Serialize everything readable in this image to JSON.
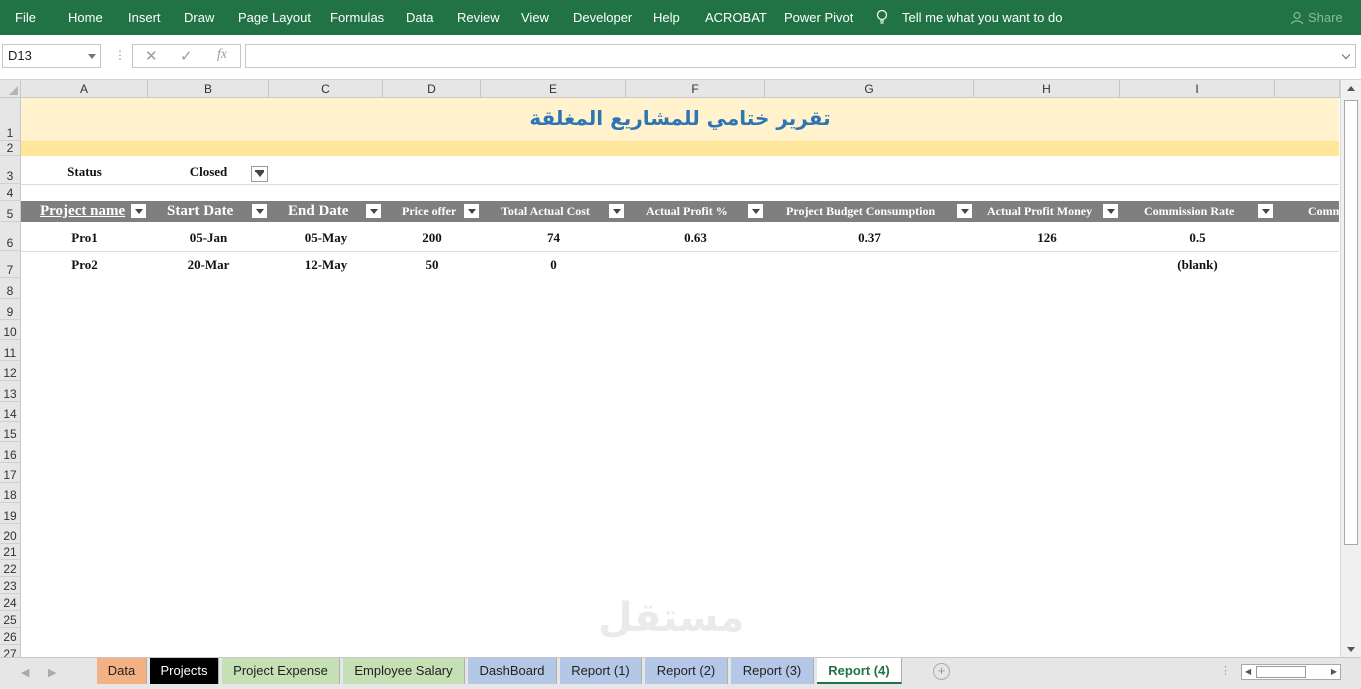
{
  "ribbon": {
    "tabs": [
      "File",
      "Home",
      "Insert",
      "Draw",
      "Page Layout",
      "Formulas",
      "Data",
      "Review",
      "View",
      "Developer",
      "Help",
      "ACROBAT",
      "Power Pivot"
    ],
    "tell_me": "Tell me what you want to do",
    "share": "Share"
  },
  "formula_bar": {
    "name_box": "D13",
    "cancel": "✕",
    "enter": "✓",
    "fx": "fx",
    "formula": ""
  },
  "columns": [
    "A",
    "B",
    "C",
    "D",
    "E",
    "F",
    "G",
    "H",
    "I"
  ],
  "rows": [
    "1",
    "2",
    "3",
    "4",
    "5",
    "6",
    "7",
    "8",
    "9",
    "10",
    "11",
    "12",
    "13",
    "14",
    "15",
    "16",
    "17",
    "18",
    "19",
    "20",
    "21",
    "22",
    "23",
    "24",
    "25",
    "26",
    "27"
  ],
  "sheet": {
    "title": "تقرير ختامي للمشاريع المغلقة",
    "filter_label": "Status",
    "filter_value": "Closed",
    "headers": [
      "Project name",
      "Start Date",
      "End Date",
      "Price offer",
      "Total Actual Cost",
      "Actual Profit %",
      "Project Budget Consumption",
      "Actual Profit Money",
      "Commission Rate",
      "Comm"
    ],
    "data_rows": [
      [
        "Pro1",
        "05-Jan",
        "05-May",
        "200",
        "74",
        "0.63",
        "0.37",
        "126",
        "0.5"
      ],
      [
        "Pro2",
        "20-Mar",
        "12-May",
        "50",
        "0",
        "",
        "",
        "",
        "(blank)"
      ]
    ]
  },
  "sheet_tabs": [
    {
      "label": "Data",
      "color": "#f4b183"
    },
    {
      "label": "Projects",
      "color": "#000000"
    },
    {
      "label": "Project Expense",
      "color": "#c5e0b4"
    },
    {
      "label": "Employee Salary",
      "color": "#c5e0b4"
    },
    {
      "label": "DashBoard",
      "color": "#b4c7e7"
    },
    {
      "label": "Report (1)",
      "color": "#b4c7e7"
    },
    {
      "label": "Report (2)",
      "color": "#b4c7e7"
    },
    {
      "label": "Report (3)",
      "color": "#b4c7e7"
    },
    {
      "label": "Report (4)",
      "color": "#ffffff"
    }
  ],
  "watermark": "مستقل",
  "colors": {
    "ribbon": "#217346",
    "title": "#2e75b6",
    "title_band": "#fff2cc",
    "title_band2": "#ffe699",
    "header_band": "#7f7f7f"
  }
}
